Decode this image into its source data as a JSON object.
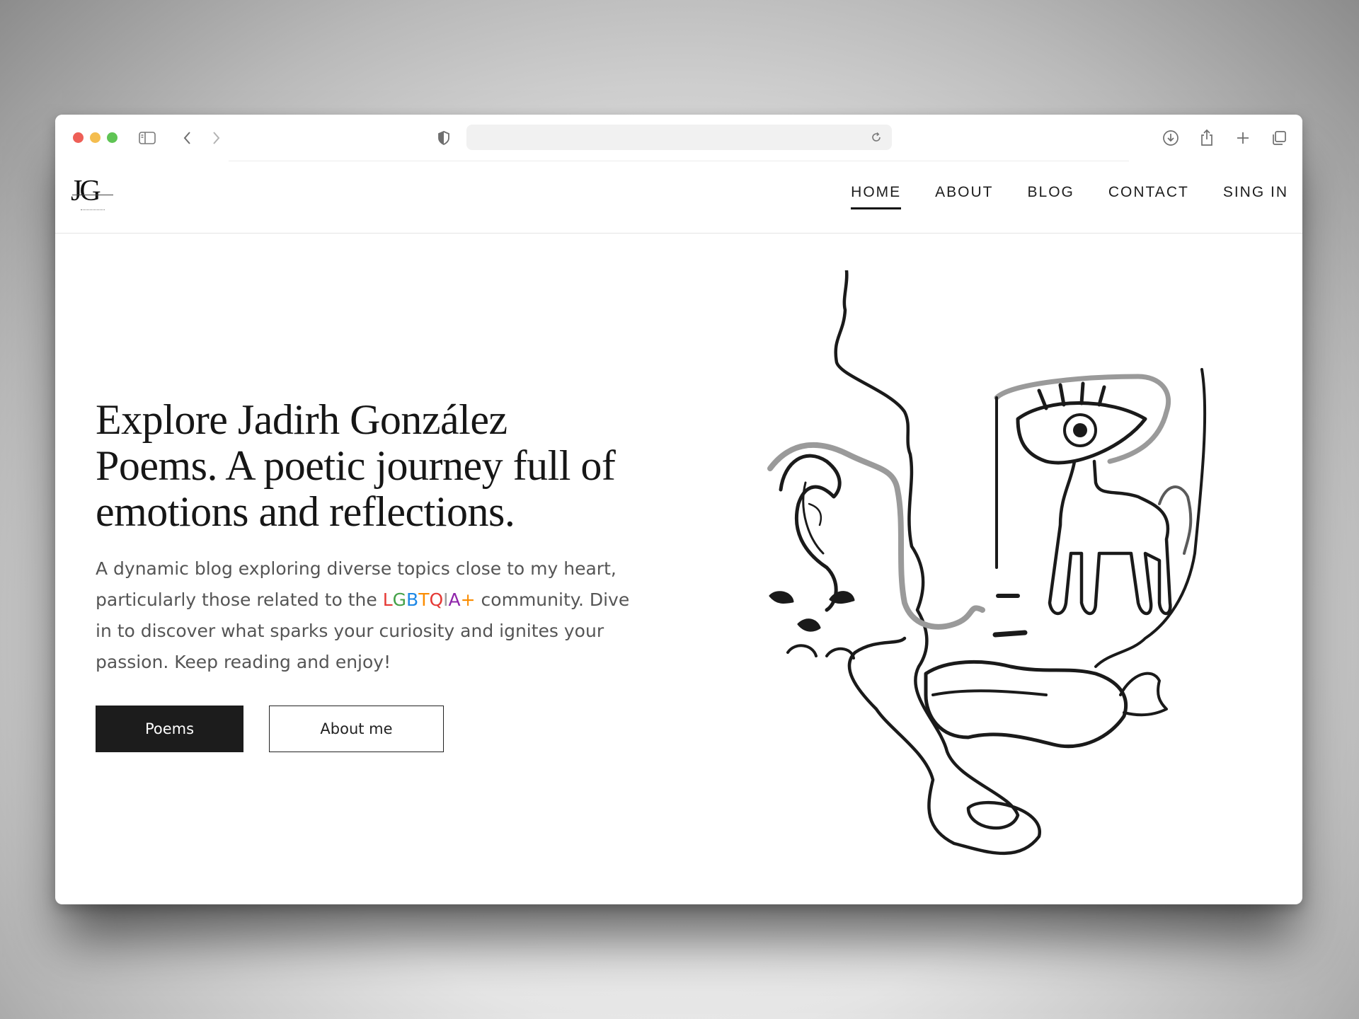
{
  "browser": {
    "url": "",
    "icons": [
      "sidebar-icon",
      "back-icon",
      "forward-icon",
      "shield-icon",
      "reload-icon",
      "download-icon",
      "share-icon",
      "new-tab-icon",
      "tabs-overview-icon"
    ]
  },
  "site": {
    "logo": "JG",
    "nav": [
      {
        "label": "HOME",
        "active": true
      },
      {
        "label": "ABOUT",
        "active": false
      },
      {
        "label": "BLOG",
        "active": false
      },
      {
        "label": "CONTACT",
        "active": false
      },
      {
        "label": "SING IN",
        "active": false
      }
    ]
  },
  "hero": {
    "title": "Explore Jadirh González Poems. A poetic journey full of emotions and reflections.",
    "desc_before": "A dynamic blog exploring diverse topics close to my heart, particularly those related to the ",
    "desc_highlight": "LGBTQIA+",
    "desc_after": " community. Dive in to discover what sparks your curiosity and ignites your passion. Keep reading and enjoy!",
    "highlight_colors": [
      "#e53935",
      "#43a047",
      "#1e88e5",
      "#fb8c00",
      "#e53935",
      "#9e9e9e",
      "#8e24aa",
      "#fb8c00"
    ]
  },
  "buttons": {
    "primary": "Poems",
    "secondary": "About me"
  },
  "colors": {
    "traffic_red": "#ee5f57",
    "traffic_yellow": "#f4bd4f",
    "traffic_green": "#5fc454",
    "button_dark": "#1c1c1c"
  }
}
